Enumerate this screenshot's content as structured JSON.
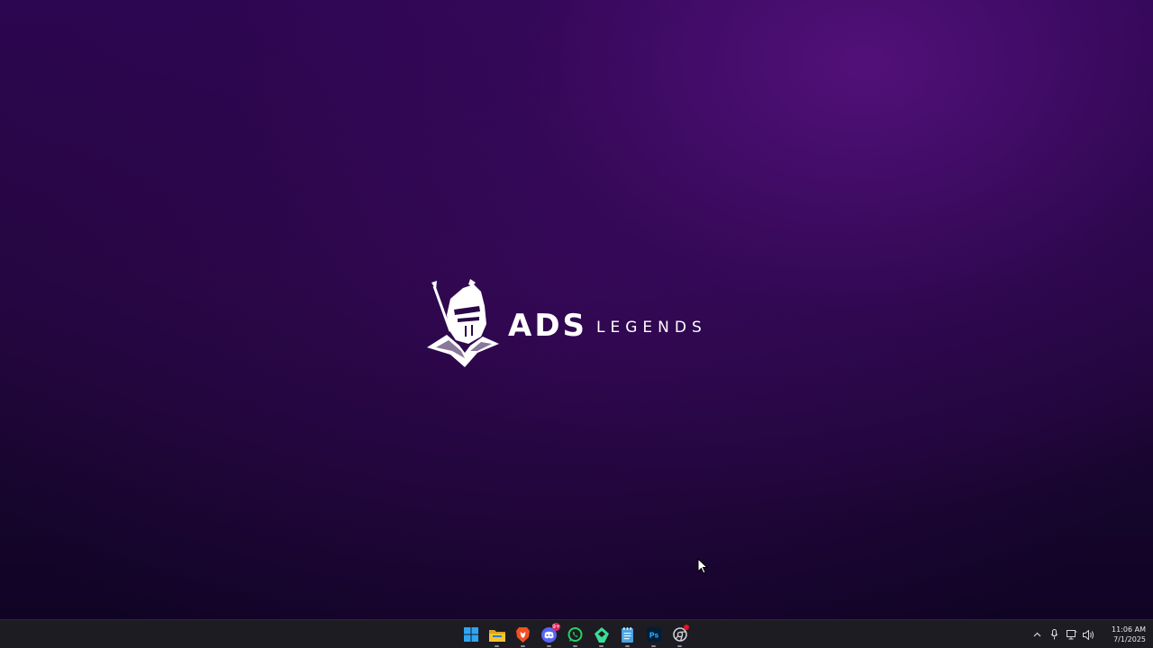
{
  "wallpaper": {
    "logo_primary": "ADS",
    "logo_secondary": "LEGENDS"
  },
  "taskbar": {
    "apps": [
      {
        "name": "start-button",
        "icon": "windows-icon",
        "color": "#2fa5f2"
      },
      {
        "name": "file-explorer",
        "icon": "folder-icon",
        "color": "#f4c430"
      },
      {
        "name": "brave-browser",
        "icon": "brave-lion-icon",
        "color": "#f25022"
      },
      {
        "name": "discord",
        "icon": "discord-icon",
        "color": "#5865f2",
        "badge": "9+"
      },
      {
        "name": "whatsapp",
        "icon": "whatsapp-icon",
        "color": "#25d366"
      },
      {
        "name": "vpn-app",
        "icon": "shield-icon",
        "color": "#3ddc97"
      },
      {
        "name": "notepad",
        "icon": "notepad-icon",
        "color": "#4aa3df"
      },
      {
        "name": "photoshop",
        "icon": "photoshop-icon",
        "color": "#31a8ff",
        "label": "Ps"
      },
      {
        "name": "chrome-app",
        "icon": "chrome-icon",
        "color": "#cfcfd6"
      }
    ],
    "tray": {
      "icons": [
        "chevron-up-icon",
        "microphone-icon",
        "network-icon",
        "speaker-icon"
      ],
      "time": "11:06 AM",
      "date": "7/1/2025"
    }
  }
}
